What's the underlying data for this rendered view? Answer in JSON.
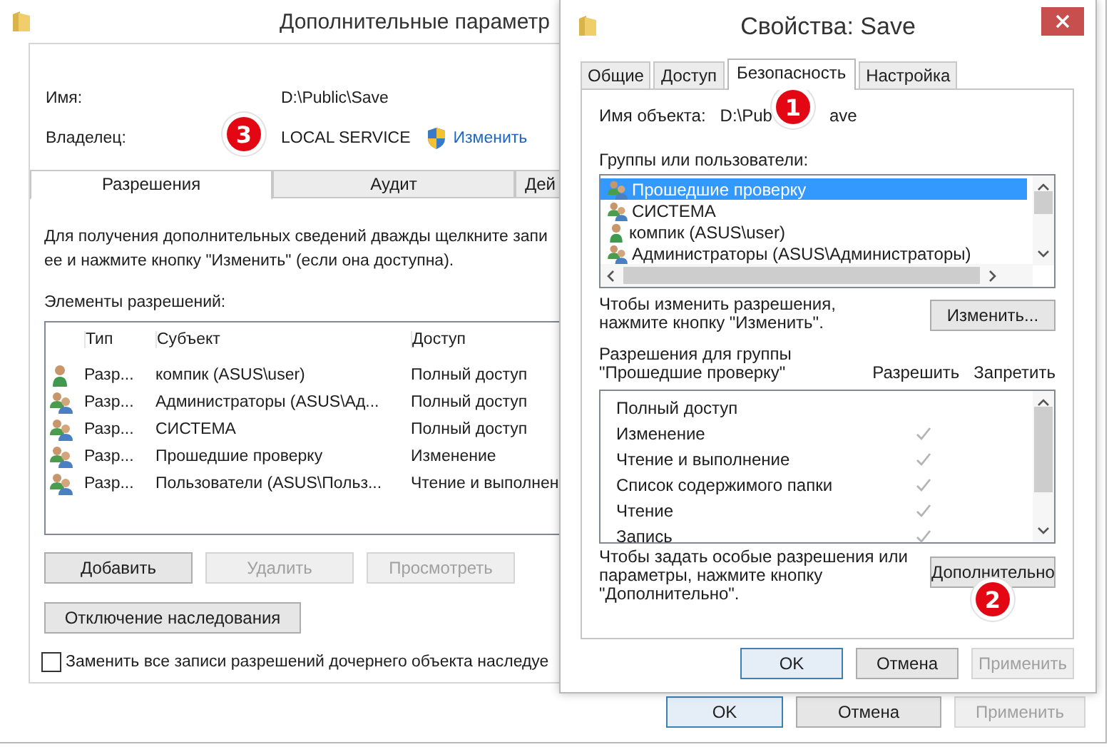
{
  "back_window": {
    "title": "Дополнительные параметр",
    "name_label": "Имя:",
    "name_value": "D:\\Public\\Save",
    "owner_label": "Владелец:",
    "owner_value": "LOCAL SERVICE",
    "owner_link": "Изменить",
    "tabs": [
      {
        "label": "Разрешения",
        "selected": true
      },
      {
        "label": "Аудит",
        "selected": false
      },
      {
        "label": "Дей",
        "selected": false
      }
    ],
    "info_lines": [
      "Для получения дополнительных сведений дважды щелкните запи",
      "ее и нажмите кнопку \"Изменить\" (если она доступна)."
    ],
    "entries_label": "Элементы разрешений:",
    "table": {
      "columns": [
        "Тип",
        "Субъект",
        "Доступ"
      ],
      "rows": [
        {
          "kind": "user",
          "type": "Разр...",
          "principal": "компик (ASUS\\user)",
          "access": "Полный доступ"
        },
        {
          "kind": "group",
          "type": "Разр...",
          "principal": "Администраторы (ASUS\\Ад...",
          "access": "Полный доступ"
        },
        {
          "kind": "group",
          "type": "Разр...",
          "principal": "СИСТЕМА",
          "access": "Полный доступ"
        },
        {
          "kind": "group",
          "type": "Разр...",
          "principal": "Прошедшие проверку",
          "access": "Изменение"
        },
        {
          "kind": "group",
          "type": "Разр...",
          "principal": "Пользователи (ASUS\\Польз...",
          "access": "Чтение и выполнен"
        }
      ]
    },
    "buttons": [
      {
        "label": "Добавить",
        "disabled": false
      },
      {
        "label": "Удалить",
        "disabled": true
      },
      {
        "label": "Просмотреть",
        "disabled": true
      }
    ],
    "inheritance_button": "Отключение наследования",
    "replace_checkbox": {
      "label": "Заменить все записи разрешений дочернего объекта наследуе",
      "checked": false
    },
    "footer_buttons": [
      {
        "label": "OK",
        "disabled": false,
        "default": true
      },
      {
        "label": "Отмена",
        "disabled": false,
        "default": false
      },
      {
        "label": "Применить",
        "disabled": true,
        "default": false
      }
    ]
  },
  "front_window": {
    "title": "Свойства: Save",
    "tabs": [
      {
        "label": "Общие",
        "selected": false
      },
      {
        "label": "Доступ",
        "selected": false
      },
      {
        "label": "Безопасность",
        "selected": true
      },
      {
        "label": "Настройка",
        "selected": false
      }
    ],
    "object_label": "Имя объекта:",
    "object_value": [
      "D:\\Pub",
      "ave"
    ],
    "groups_label": "Группы или пользователи:",
    "groups": [
      {
        "kind": "group",
        "name": "Прошедшие проверку",
        "selected": true
      },
      {
        "kind": "group",
        "name": "СИСТЕМА",
        "selected": false
      },
      {
        "kind": "user",
        "name": "компик (ASUS\\user)",
        "selected": false
      },
      {
        "kind": "group",
        "name": "Администраторы (ASUS\\Администраторы)",
        "selected": false
      }
    ],
    "change_hint": [
      "Чтобы изменить разрешения,",
      "нажмите кнопку \"Изменить\"."
    ],
    "change_button": "Изменить...",
    "perms_label": [
      "Разрешения для группы",
      "\"Прошедшие проверку\""
    ],
    "allow_header": "Разрешить",
    "deny_header": "Запретить",
    "permissions": [
      {
        "name": "Полный доступ",
        "allow": false,
        "deny": false
      },
      {
        "name": "Изменение",
        "allow": true,
        "deny": false
      },
      {
        "name": "Чтение и выполнение",
        "allow": true,
        "deny": false
      },
      {
        "name": "Список содержимого папки",
        "allow": true,
        "deny": false
      },
      {
        "name": "Чтение",
        "allow": true,
        "deny": false
      },
      {
        "name": "Запись",
        "allow": true,
        "deny": false
      }
    ],
    "advanced_hint": [
      "Чтобы задать особые разрешения или",
      "параметры, нажмите кнопку",
      "\"Дополнительно\"."
    ],
    "advanced_button": "Дополнительно",
    "footer_buttons": [
      {
        "label": "OK",
        "disabled": false,
        "default": true
      },
      {
        "label": "Отмена",
        "disabled": false,
        "default": false
      },
      {
        "label": "Применить",
        "disabled": true,
        "default": false
      }
    ]
  },
  "annotations": [
    {
      "number": "1"
    },
    {
      "number": "2"
    },
    {
      "number": "3"
    }
  ]
}
